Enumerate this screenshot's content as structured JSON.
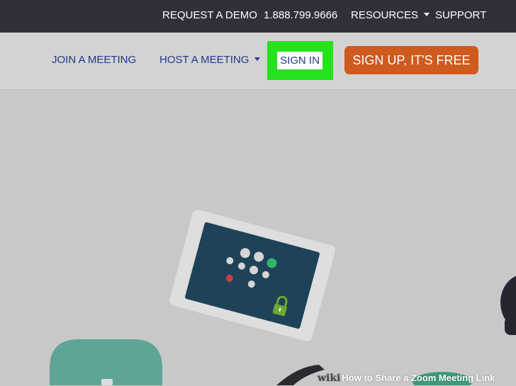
{
  "topbar": {
    "request_demo": "REQUEST A DEMO",
    "phone": "1.888.799.9666",
    "resources": "RESOURCES",
    "support": "SUPPORT"
  },
  "nav": {
    "join_meeting": "JOIN A MEETING",
    "host_meeting": "HOST A MEETING",
    "sign_in": "SIGN IN",
    "sign_up": "SIGN UP, IT'S FREE"
  },
  "watermark": {
    "brand_wiki": "wiki",
    "brand_how": "How",
    "title": "to Share a Zoom Meeting Link"
  },
  "colors": {
    "topbar_bg": "#30303a",
    "nav_bg": "#d3d3d3",
    "nav_link": "#1f3a86",
    "highlight": "#26e21d",
    "signup_bg": "#cf5a1e",
    "hero_bg": "#c8c8c8",
    "tablet_screen": "#1e4258"
  },
  "icons": [
    "caret-down-icon",
    "padlock-icon",
    "tablet-illustration",
    "chat-bubble-illustration",
    "microphone-illustration"
  ]
}
